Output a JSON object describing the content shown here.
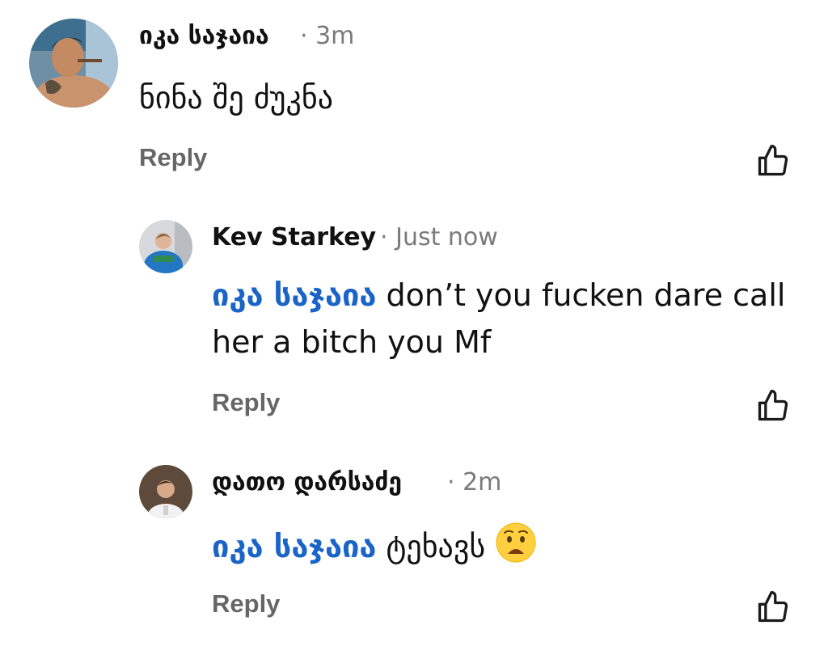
{
  "comments": [
    {
      "author": "იკა საჯაია",
      "time": "3m",
      "text": "ნინა შე ძუკნა",
      "reply_label": "Reply"
    },
    {
      "author": "Kev Starkey",
      "time": "Just now",
      "mention": "იკა საჯაია",
      "text": "don’t you fucken dare call her a bitch you Mf",
      "reply_label": "Reply"
    },
    {
      "author": "დათო დარსაძე",
      "time": "2m",
      "mention": "იკა საჯაია",
      "text": "ტეხავს",
      "emoji": "worried-face-emoji",
      "reply_label": "Reply"
    }
  ],
  "meta_separator": "·",
  "icons": {
    "like": "thumbs-up-icon"
  },
  "colors": {
    "mention": "#1a64c8",
    "meta": "#7a7a7a",
    "reply": "#666666"
  }
}
